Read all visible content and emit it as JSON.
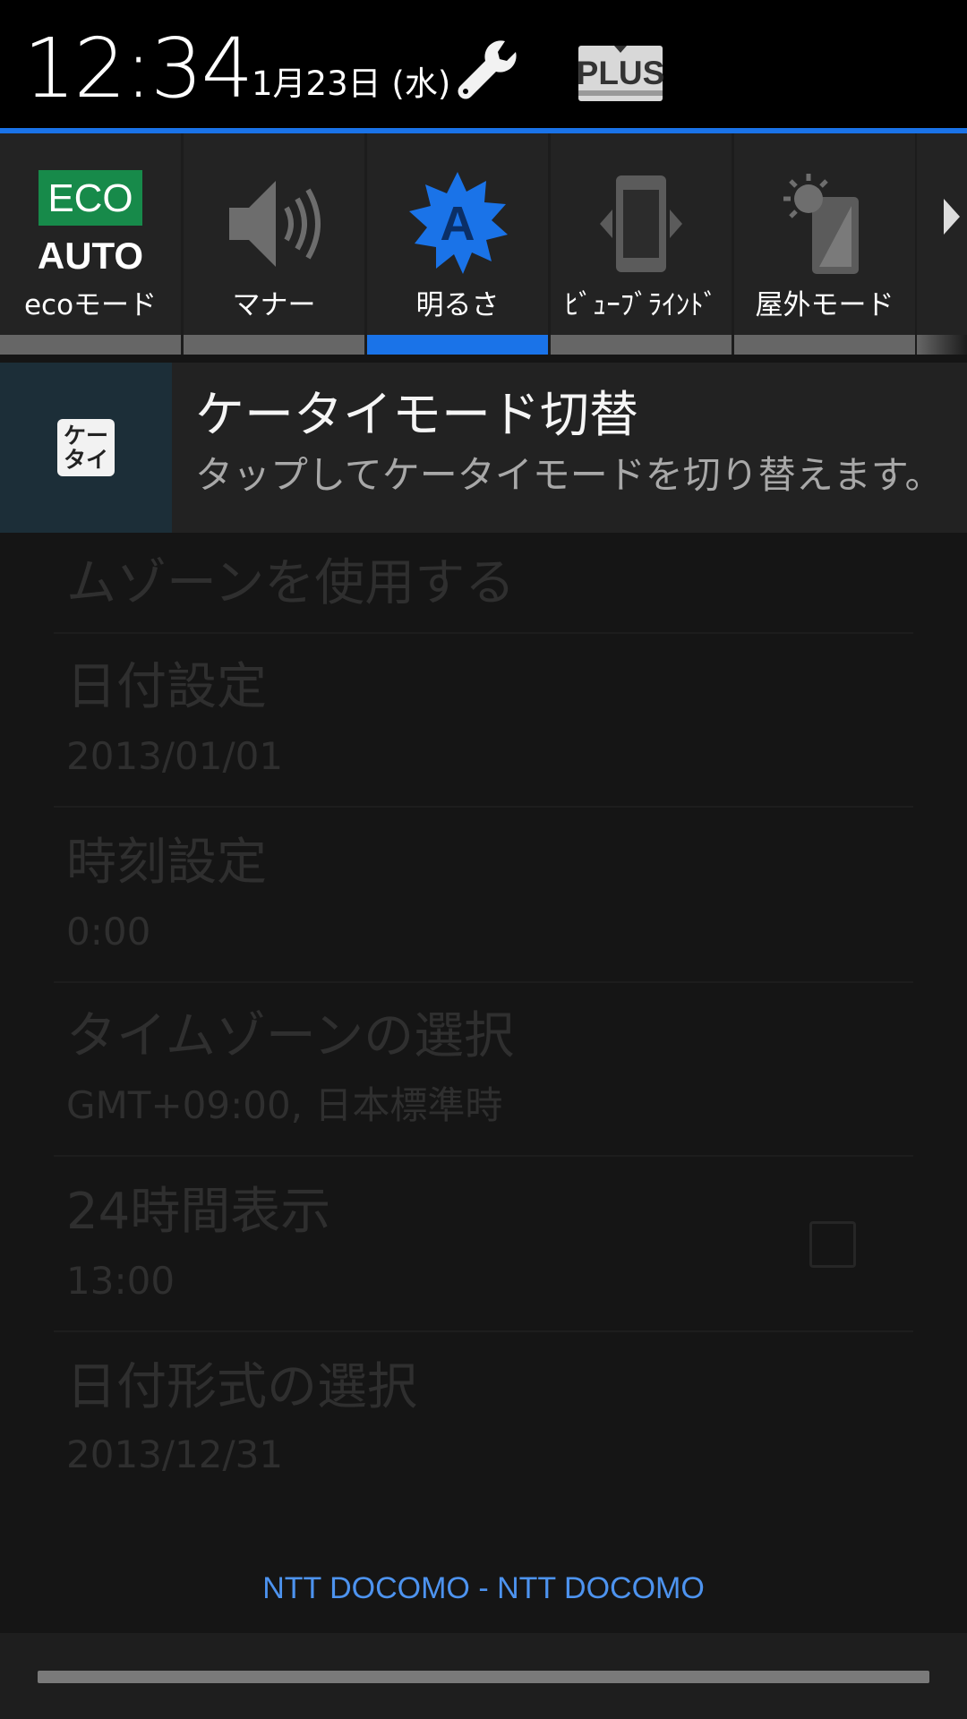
{
  "status": {
    "time": "12:34",
    "date": "1月23日 (水)",
    "settings_icon": "wrench-icon",
    "plus_button_label": "PLUS"
  },
  "quick_settings": {
    "tiles": [
      {
        "label": "ecoモード",
        "icon": "eco-auto-icon",
        "icon_text_top": "ECO",
        "icon_text_bottom": "AUTO",
        "active": false
      },
      {
        "label": "マナー",
        "icon": "speaker-icon",
        "active": false
      },
      {
        "label": "明るさ",
        "icon": "brightness-auto-icon",
        "icon_text": "A",
        "active": true
      },
      {
        "label": "ﾋﾞｭｰﾌﾞﾗｲﾝﾄﾞ",
        "icon": "view-blind-icon",
        "active": false
      },
      {
        "label": "屋外モード",
        "icon": "outdoor-mode-icon",
        "active": false
      }
    ],
    "more_icon": "chevron-right-icon",
    "accent_color": "#1a73e8"
  },
  "notification": {
    "icon_text_line1": "ケー",
    "icon_text_line2": "タイ",
    "title": "ケータイモード切替",
    "text": "タップしてケータイモードを切り替えます。"
  },
  "background_settings": {
    "items": [
      {
        "title": "ムゾーンを使用する",
        "sub": ""
      },
      {
        "title": "日付設定",
        "sub": "2013/01/01"
      },
      {
        "title": "時刻設定",
        "sub": "0:00"
      },
      {
        "title": "タイムゾーンの選択",
        "sub": "GMT+09:00, 日本標準時"
      },
      {
        "title": "24時間表示",
        "sub": "13:00"
      },
      {
        "title": "日付形式の選択",
        "sub": "2013/12/31"
      }
    ]
  },
  "footer": {
    "carrier": "NTT DOCOMO - NTT DOCOMO"
  }
}
